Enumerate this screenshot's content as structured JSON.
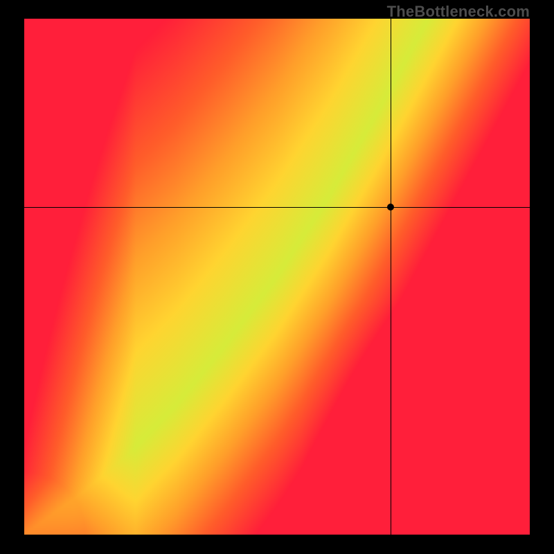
{
  "watermark": "TheBottleneck.com",
  "chart_data": {
    "type": "heatmap",
    "title": "",
    "xlabel": "",
    "ylabel": "",
    "xlim": [
      0,
      1
    ],
    "ylim": [
      0,
      1
    ],
    "crosshair": {
      "x": 0.725,
      "y": 0.635
    },
    "marker": {
      "x": 0.725,
      "y": 0.635
    },
    "description": "2D gradient field: green diagonal ridge (optimal) curving from bottom-left to upper-middle; transitions through yellow to orange to red away from the ridge. Red dominates lower-right and left; yellow dominates upper-right and a band around the ridge.",
    "ridge_control_points_x": [
      0.0,
      0.1,
      0.2,
      0.3,
      0.4,
      0.5,
      0.6,
      0.7,
      0.8
    ],
    "ridge_control_points_y": [
      0.0,
      0.07,
      0.15,
      0.25,
      0.37,
      0.5,
      0.65,
      0.82,
      1.0
    ],
    "color_stops": [
      {
        "t": 0.0,
        "color": "#00e28b"
      },
      {
        "t": 0.15,
        "color": "#d7ec3a"
      },
      {
        "t": 0.35,
        "color": "#ffd531"
      },
      {
        "t": 0.55,
        "color": "#ff9f2a"
      },
      {
        "t": 0.75,
        "color": "#ff5e2a"
      },
      {
        "t": 1.0,
        "color": "#ff1f3a"
      }
    ]
  }
}
